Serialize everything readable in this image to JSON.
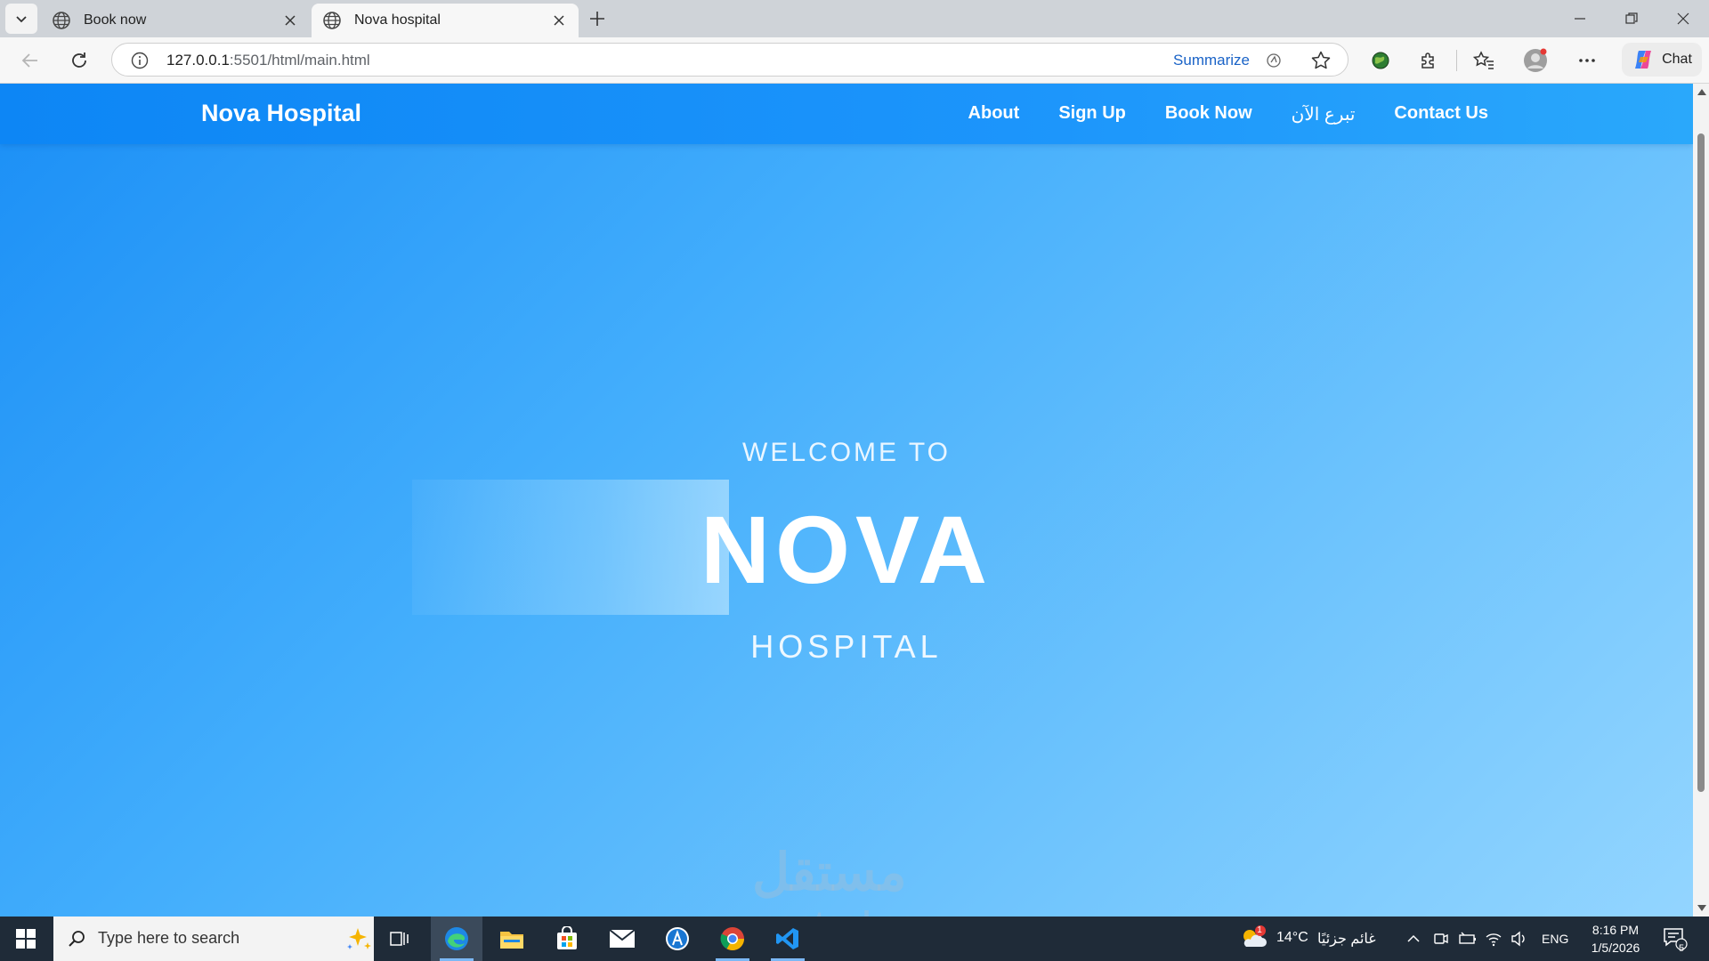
{
  "browser": {
    "tabs": [
      {
        "title": "Book now",
        "active": false
      },
      {
        "title": "Nova hospital",
        "active": true
      }
    ],
    "address": {
      "host": "127.0.0.1",
      "rest": ":5501/html/main.html"
    },
    "summarize_label": "Summarize",
    "chat_label": "Chat"
  },
  "site": {
    "brand": "Nova Hospital",
    "nav": [
      {
        "label": "About"
      },
      {
        "label": "Sign Up"
      },
      {
        "label": "Book Now"
      },
      {
        "label": "تبرع الآن"
      },
      {
        "label": "Contact Us"
      }
    ],
    "hero": {
      "welcome": "WELCOME TO",
      "title": "NOVA",
      "subtitle": "HOSPITAL"
    },
    "watermark": {
      "text": "مستقل",
      "sub": "mostaql.com"
    }
  },
  "taskbar": {
    "search_placeholder": "Type here to search",
    "weather": {
      "temp": "14°C",
      "condition": "غائم جزئيًا",
      "alert_count": "1"
    },
    "language": "ENG",
    "time": "8:16 PM",
    "date": "1/5/2026",
    "notification_count": "5"
  },
  "colors": {
    "nav_bg": "#1c95fb",
    "hero_start": "#1b8ff6",
    "hero_end": "#93d5ff",
    "taskbar": "#1f2b38"
  }
}
